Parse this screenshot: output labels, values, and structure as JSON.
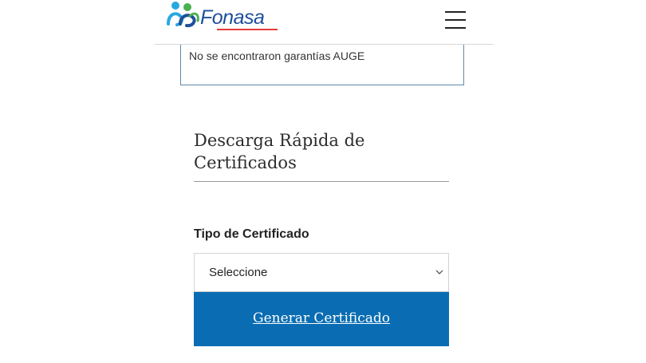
{
  "header": {
    "logo_text": "Fonasa",
    "menu_icon": "hamburger-icon"
  },
  "auge": {
    "message": "No se encontraron garantías AUGE"
  },
  "quick_download": {
    "title_line1": "Descarga Rápida de",
    "title_line2": "Certificados"
  },
  "certificate_form": {
    "type_label": "Tipo de Certificado",
    "select_value": "Seleccione",
    "generate_label": "Generar Certificado"
  },
  "colors": {
    "brand_blue": "#1d4f9c",
    "button_blue": "#0a6db3",
    "logo_accent_red": "#e63a3a",
    "logo_accent_green": "#4caf50",
    "logo_accent_cyan": "#29a8e0"
  }
}
